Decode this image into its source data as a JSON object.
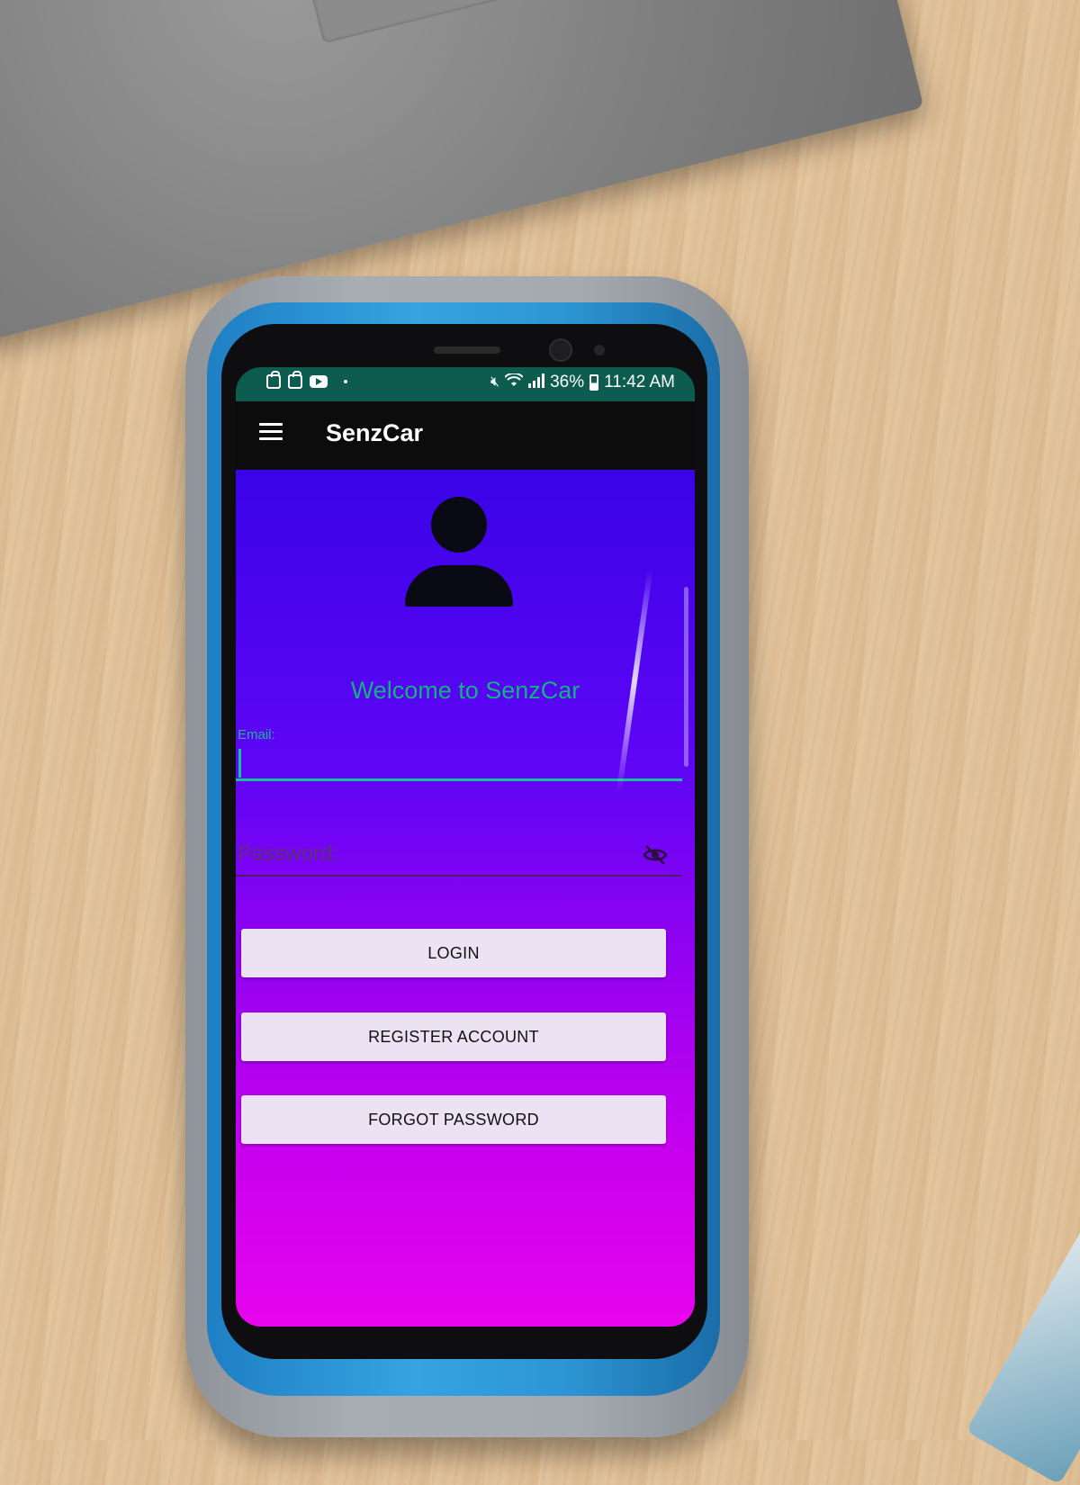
{
  "status_bar": {
    "battery_percent": "36%",
    "time": "11:42 AM",
    "notification_icons": [
      "bag-icon",
      "bag-icon",
      "youtube-icon",
      "dot-icon"
    ],
    "system_icons": [
      "mute-icon",
      "wifi-icon",
      "signal-icon",
      "battery-icon"
    ]
  },
  "app_bar": {
    "title": "SenzCar",
    "menu_icon": "hamburger-menu-icon"
  },
  "login": {
    "avatar_icon": "person-icon",
    "welcome_text": "Welcome to SenzCar",
    "email_label": "Email:",
    "email_value": "",
    "password_placeholder": "Password:",
    "password_toggle_icon": "eye-off-icon",
    "login_button": "LOGIN",
    "register_button": "REGISTER ACCOUNT",
    "forgot_button": "FORGOT PASSWORD"
  },
  "colors": {
    "status_bar": "#0c5c50",
    "app_bar": "#0c0c0c",
    "gradient_top": "#3a04e8",
    "gradient_bottom": "#e705ee",
    "accent_teal": "#13b183",
    "button_bg": "#ebe3f3"
  }
}
